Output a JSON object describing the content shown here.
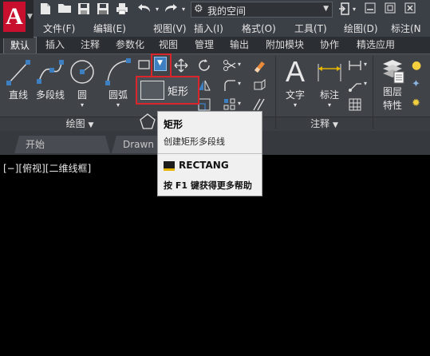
{
  "titlebar": {
    "logo_letter": "A",
    "workspace": "我的空间"
  },
  "menubar": {
    "items": [
      "文件(F)",
      "编辑(E)",
      "视图(V)",
      "插入(I)",
      "格式(O)",
      "工具(T)",
      "绘图(D)",
      "标注(N"
    ]
  },
  "ribbon_tabs": [
    "默认",
    "插入",
    "注释",
    "参数化",
    "视图",
    "管理",
    "输出",
    "附加模块",
    "协作",
    "精选应用"
  ],
  "ribbon": {
    "draw_buttons": [
      "直线",
      "多段线",
      "圆",
      "圆弧"
    ],
    "draw_panel": "绘图",
    "text_button": "文字",
    "dim_button": "标注",
    "annotation_panel": "注释",
    "layer_button_line1": "图层",
    "layer_button_line2": "特性"
  },
  "flyout": {
    "label": "矩形"
  },
  "tooltip": {
    "title": "矩形",
    "description": "创建矩形多段线",
    "command": "RECTANG",
    "help": "按 F1 键获得更多帮助"
  },
  "doc_tabs": [
    "开始",
    "Drawn"
  ],
  "viewport": {
    "label": "[−][俯视][二维线框]"
  },
  "colors": {
    "accent_red": "#d9262c",
    "logo_red": "#c8102e",
    "dropdown_blue": "#3d7fc0"
  }
}
